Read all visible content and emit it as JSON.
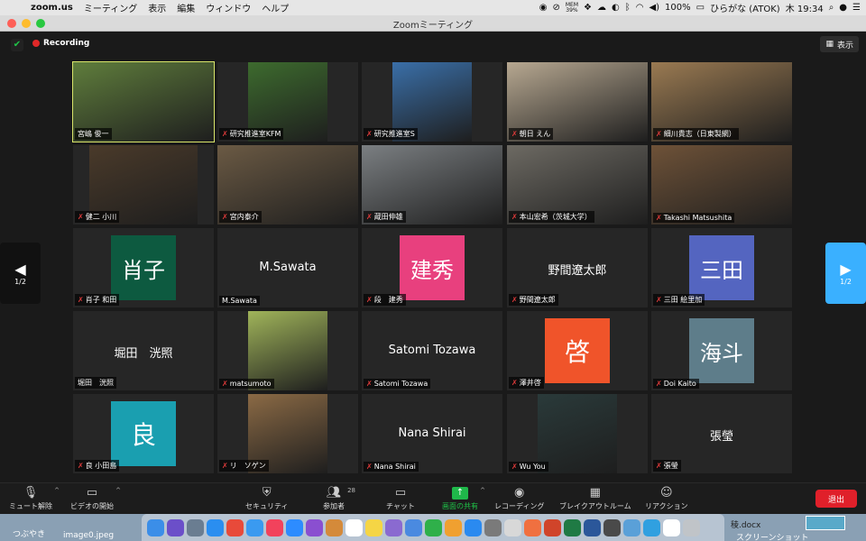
{
  "menubar": {
    "apple": "",
    "app_name": "zoom.us",
    "menus": [
      "ミーティング",
      "表示",
      "編集",
      "ウィンドウ",
      "ヘルプ"
    ],
    "mem_top": "MEM",
    "mem_val": "39%",
    "battery": "100%",
    "ime": "ひらがな (ATOK)",
    "clock": "木 19:34"
  },
  "window": {
    "title": "Zoomミーティング"
  },
  "meeting": {
    "recording_label": "Recording",
    "view_label": "表示",
    "page_indicator_left": "1/2",
    "page_indicator_right": "1/2"
  },
  "tiles": [
    {
      "name": "宮嶋 俊一",
      "kind": "photo",
      "bg": "#5f7d3c",
      "muted": false,
      "active": true
    },
    {
      "name": "研究推進室KFM",
      "kind": "photo",
      "bg": "#3d6b2e",
      "muted": true
    },
    {
      "name": "研究推進室S",
      "kind": "photo",
      "bg": "#3a6fa8",
      "muted": true
    },
    {
      "name": "朝日 えん",
      "kind": "photo",
      "bg": "#b7a891",
      "muted": true
    },
    {
      "name": "細川貴志（日東製網）",
      "kind": "photo",
      "bg": "#9a7a52",
      "muted": true
    },
    {
      "name": "健二 小川",
      "kind": "photo",
      "bg": "#4a3a2a",
      "muted": true
    },
    {
      "name": "宮内泰介",
      "kind": "photo",
      "bg": "#6b5a44",
      "muted": true
    },
    {
      "name": "蔵田伸雄",
      "kind": "photo",
      "bg": "#7b7f82",
      "muted": true
    },
    {
      "name": "本山宏希（茨城大学）",
      "kind": "photo",
      "bg": "#6d6a63",
      "muted": true
    },
    {
      "name": "Takashi Matsushita",
      "kind": "photo",
      "bg": "#6e5238",
      "muted": true
    },
    {
      "name": "肖子 和田",
      "kind": "avatar",
      "avatar_text": "肖子",
      "avatar_bg": "#0d5a40",
      "muted": true
    },
    {
      "name": "M.Sawata",
      "kind": "text",
      "display": "M.Sawata",
      "muted": false
    },
    {
      "name": "段　建秀",
      "kind": "avatar",
      "avatar_text": "建秀",
      "avatar_bg": "#e8407e",
      "muted": true
    },
    {
      "name": "野間遼太郎",
      "kind": "text",
      "display": "野間遼太郎",
      "muted": true
    },
    {
      "name": "三田 絵里加",
      "kind": "avatar",
      "avatar_text": "三田",
      "avatar_bg": "#5465c0",
      "muted": true
    },
    {
      "name": "堀田　洸照",
      "kind": "text",
      "display": "堀田　洸照",
      "muted": false
    },
    {
      "name": "matsumoto",
      "kind": "photo",
      "bg": "#a0b45a",
      "muted": true
    },
    {
      "name": "Satomi Tozawa",
      "kind": "text",
      "display": "Satomi Tozawa",
      "muted": true
    },
    {
      "name": "澤井啓",
      "kind": "avatar",
      "avatar_text": "啓",
      "avatar_bg": "#f0542a",
      "muted": true
    },
    {
      "name": "Doi Kaito",
      "kind": "avatar",
      "avatar_text": "海斗",
      "avatar_bg": "#5e7d8a",
      "muted": true
    },
    {
      "name": "良 小田島",
      "kind": "avatar",
      "avatar_text": "良",
      "avatar_bg": "#1a9fb0",
      "muted": true
    },
    {
      "name": "リ　ソゲン",
      "kind": "photo",
      "bg": "#8b6a45",
      "muted": true
    },
    {
      "name": "Nana Shirai",
      "kind": "text",
      "display": "Nana Shirai",
      "muted": true
    },
    {
      "name": "Wu You",
      "kind": "photo",
      "bg": "#2a3a3a",
      "muted": true
    },
    {
      "name": "張瑩",
      "kind": "text",
      "display": "張瑩",
      "muted": true
    }
  ],
  "toolbar": {
    "unmute": "ミュート解除",
    "start_video": "ビデオの開始",
    "security": "セキュリティ",
    "participants": "参加者",
    "participant_count": "28",
    "chat": "チャット",
    "share": "画面の共有",
    "record": "レコーディング",
    "breakout": "ブレイクアウトルーム",
    "reactions": "リアクション",
    "leave": "退出"
  },
  "desktop": {
    "left_label1": "つぶやき",
    "left_label2": "image0.jpeg",
    "right_label1": "稜.docx",
    "right_label2": "スクリーンショット"
  },
  "dock_apps": [
    {
      "icon": "finder-icon",
      "color": "#3b8ee8"
    },
    {
      "icon": "siri-icon",
      "color": "#6b4fc9"
    },
    {
      "icon": "rocket-icon",
      "color": "#6a7d91"
    },
    {
      "icon": "safari-icon",
      "color": "#2a8ef0"
    },
    {
      "icon": "chrome-icon",
      "color": "#e84a3a"
    },
    {
      "icon": "mail-icon",
      "color": "#3a9af0"
    },
    {
      "icon": "music-icon",
      "color": "#f2425c"
    },
    {
      "icon": "zoom-icon",
      "color": "#2d8cff"
    },
    {
      "icon": "tasks-icon",
      "color": "#8a4fd0"
    },
    {
      "icon": "finder-icon",
      "color": "#d48a3a"
    },
    {
      "icon": "calendar-icon",
      "color": "#ffffff"
    },
    {
      "icon": "notes-icon",
      "color": "#f5d545"
    },
    {
      "icon": "preview-icon",
      "color": "#8a6ad0"
    },
    {
      "icon": "doc-icon",
      "color": "#4a8ae0"
    },
    {
      "icon": "numbers-icon",
      "color": "#2fb04a"
    },
    {
      "icon": "keynote-icon",
      "color": "#f0a030"
    },
    {
      "icon": "appstore-icon",
      "color": "#2a8af0"
    },
    {
      "icon": "settings-icon",
      "color": "#7a7a7a"
    },
    {
      "icon": "sheet-icon",
      "color": "#d8d8d8"
    },
    {
      "icon": "photos-icon",
      "color": "#f07040"
    },
    {
      "icon": "powerpoint-icon",
      "color": "#d0442a"
    },
    {
      "icon": "excel-icon",
      "color": "#1f7a44"
    },
    {
      "icon": "word-icon",
      "color": "#2b579a"
    },
    {
      "icon": "app-icon",
      "color": "#4a4a4a"
    },
    {
      "icon": "folder-icon",
      "color": "#5aa0d8"
    },
    {
      "icon": "browser-icon",
      "color": "#30a0e0"
    },
    {
      "icon": "qr-icon",
      "color": "#ffffff"
    },
    {
      "icon": "trash-icon",
      "color": "#c0c4c8"
    }
  ]
}
